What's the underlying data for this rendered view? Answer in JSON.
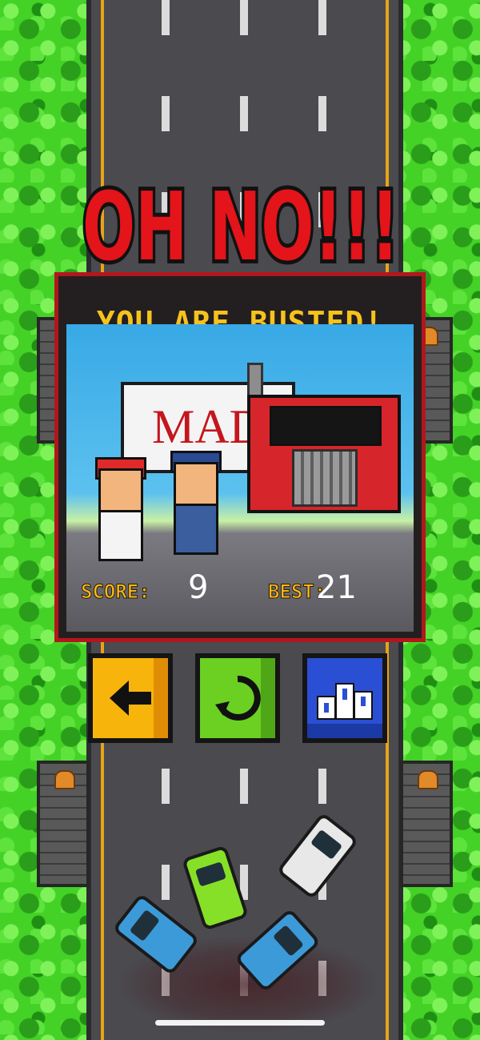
{
  "header": {
    "title": "OH NO!!!",
    "subtitle": "YOU ARE BUSTED!"
  },
  "scene": {
    "sign_text": "MAD"
  },
  "stats": {
    "score_label": "SCORE:",
    "score_value": "9",
    "best_label": "BEST:",
    "best_value": "21"
  },
  "buttons": {
    "back_icon": "arrow-left-icon",
    "replay_icon": "replay-icon",
    "leaderboard_icon": "podium-icon"
  },
  "colors": {
    "headline_red": "#e3141a",
    "subtitle_yellow": "#f6c21d",
    "panel_border": "#b3161d",
    "back_button": "#f7b40b",
    "replay_button": "#6bd021",
    "leaderboard_button": "#2b4fd4"
  }
}
